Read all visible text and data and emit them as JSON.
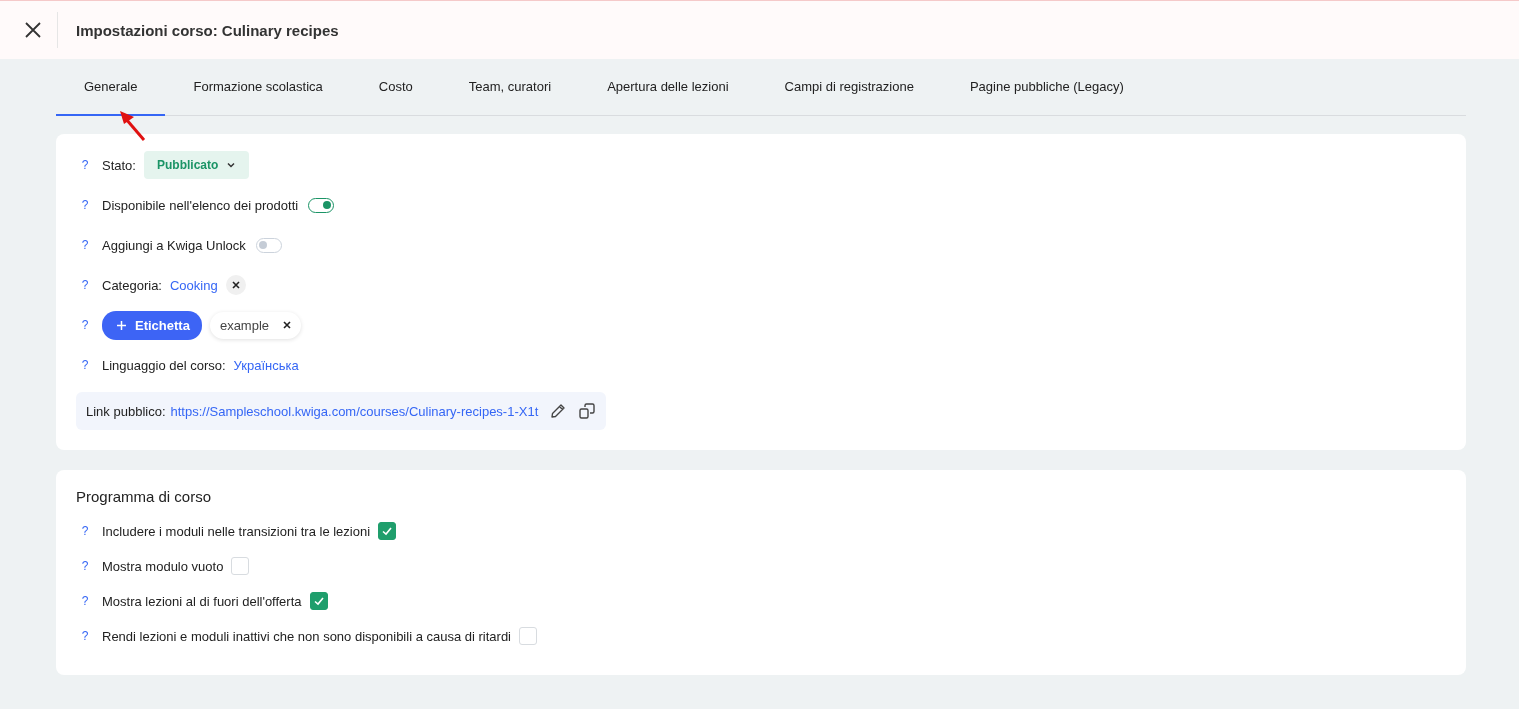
{
  "header": {
    "title": "Impostazioni corso: Culinary recipes"
  },
  "tabs": [
    {
      "label": "Generale",
      "selected": true
    },
    {
      "label": "Formazione scolastica",
      "selected": false
    },
    {
      "label": "Costo",
      "selected": false
    },
    {
      "label": "Team, curatori",
      "selected": false
    },
    {
      "label": "Apertura delle lezioni",
      "selected": false
    },
    {
      "label": "Campi di registrazione",
      "selected": false
    },
    {
      "label": "Pagine pubbliche (Legacy)",
      "selected": false
    }
  ],
  "general": {
    "fields": [
      {
        "kind": "status",
        "help": "?",
        "label": "Stato:",
        "value": "Pubblicato"
      },
      {
        "kind": "toggle",
        "help": "?",
        "label": "Disponibile nell'elenco dei prodotti",
        "on": true
      },
      {
        "kind": "toggle",
        "help": "?",
        "label": "Aggiungi a Kwiga Unlock",
        "on": false
      },
      {
        "kind": "category",
        "help": "?",
        "label": "Categoria:",
        "value": "Cooking"
      },
      {
        "kind": "tags",
        "help": "?",
        "button": "Etichetta",
        "tags": [
          "example"
        ]
      },
      {
        "kind": "language",
        "help": "?",
        "label": "Linguaggio del corso:",
        "value": "Українська"
      }
    ],
    "link": {
      "label": "Link pubblico:",
      "url": "https://Sampleschool.kwiga.com/courses/Culinary-recipes-1-X1t"
    }
  },
  "program": {
    "title": "Programma di corso",
    "options": [
      {
        "help": "?",
        "label": "Includere i moduli nelle transizioni tra le lezioni",
        "checked": true
      },
      {
        "help": "?",
        "label": "Mostra modulo vuoto",
        "checked": false
      },
      {
        "help": "?",
        "label": "Mostra lezioni al di fuori dell'offerta",
        "checked": true
      },
      {
        "help": "?",
        "label": "Rendi lezioni e moduli inattivi che non sono disponibili a causa di ritardi",
        "checked": false
      }
    ]
  }
}
